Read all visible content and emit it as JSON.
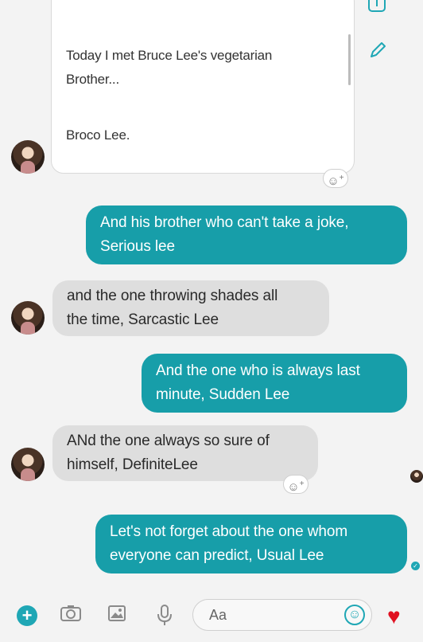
{
  "post": {
    "line1": "Today I met Bruce Lee's vegetarian\nBrother...",
    "line2": "Broco Lee."
  },
  "messages": [
    {
      "side": "out",
      "text": "And his brother who can't take a joke,\nSerious lee"
    },
    {
      "side": "in",
      "text": "and the one throwing shades all\nthe time, Sarcastic Lee"
    },
    {
      "side": "out",
      "text": "And the one who is always last\nminute, Sudden Lee"
    },
    {
      "side": "in",
      "text": "ANd the one always so sure of\nhimself, DefiniteLee"
    },
    {
      "side": "out",
      "text": "Let's not forget about the one whom\neveryone can predict, Usual Lee"
    }
  ],
  "reaction_glyph": "☺",
  "reaction_plus": "+",
  "composer": {
    "placeholder": "Aa",
    "plus": "+",
    "heart": "♥"
  },
  "colors": {
    "accent": "#1fa7b5",
    "outgoing_bubble": "#179ea9",
    "incoming_bubble": "#dedede",
    "heart": "#e01020"
  },
  "icons": [
    "plus-icon",
    "camera-icon",
    "image-icon",
    "microphone-icon",
    "emoji-icon",
    "heart-icon",
    "edit-pencil-icon",
    "share-icon"
  ]
}
